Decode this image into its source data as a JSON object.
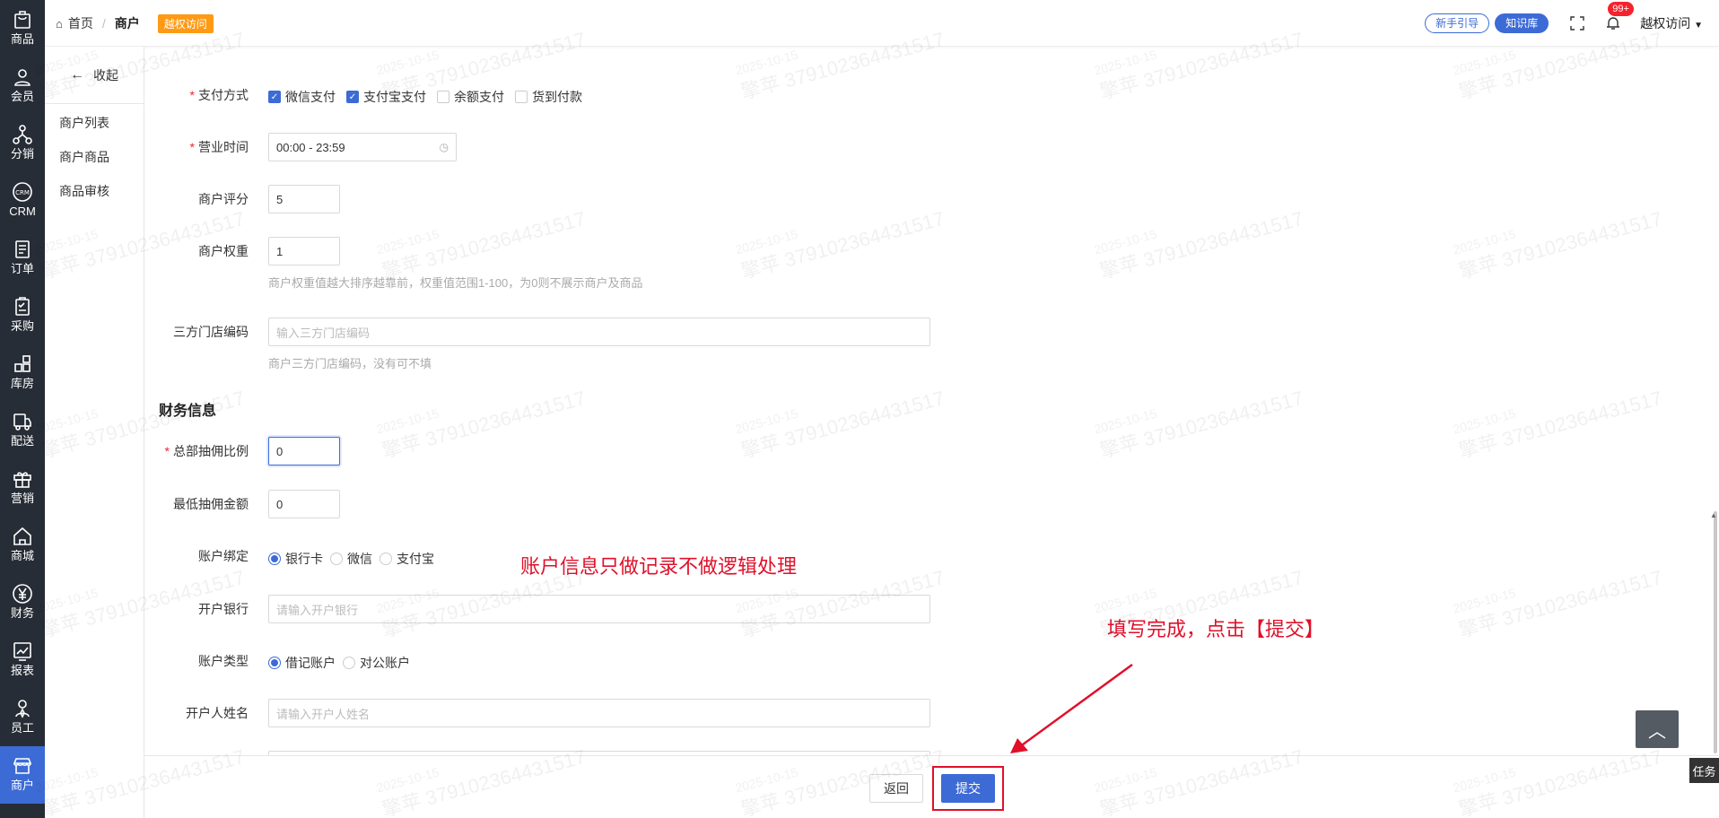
{
  "nav": {
    "items": [
      {
        "label": "商品",
        "icon": "bag-icon"
      },
      {
        "label": "会员",
        "icon": "user-icon"
      },
      {
        "label": "分销",
        "icon": "network-icon"
      },
      {
        "label": "CRM",
        "icon": "crm-icon"
      },
      {
        "label": "订单",
        "icon": "order-icon"
      },
      {
        "label": "采购",
        "icon": "purchase-icon"
      },
      {
        "label": "库房",
        "icon": "warehouse-icon"
      },
      {
        "label": "配送",
        "icon": "truck-icon"
      },
      {
        "label": "营销",
        "icon": "gift-icon"
      },
      {
        "label": "商城",
        "icon": "home-icon"
      },
      {
        "label": "财务",
        "icon": "yen-icon"
      },
      {
        "label": "报表",
        "icon": "chart-icon"
      },
      {
        "label": "员工",
        "icon": "staff-icon"
      },
      {
        "label": "商户",
        "icon": "store-icon"
      }
    ],
    "active": "商户"
  },
  "subnav": {
    "collapse_label": "收起",
    "items": [
      "商户列表",
      "商户商品",
      "商品审核"
    ]
  },
  "header": {
    "home": "首页",
    "current": "商户",
    "badge": "越权访问",
    "guide_button": "新手引导",
    "kb_button": "知识库",
    "bell_count": "99+",
    "user": "越权访问"
  },
  "form": {
    "payment": {
      "label": "支付方式",
      "options": [
        {
          "label": "微信支付",
          "checked": true
        },
        {
          "label": "支付宝支付",
          "checked": true
        },
        {
          "label": "余额支付",
          "checked": false
        },
        {
          "label": "货到付款",
          "checked": false
        }
      ]
    },
    "hours": {
      "label": "营业时间",
      "value": "00:00 - 23:59"
    },
    "rating": {
      "label": "商户评分",
      "value": "5"
    },
    "weight": {
      "label": "商户权重",
      "value": "1",
      "hint": "商户权重值越大排序越靠前，权重值范围1-100，为0则不展示商户及商品"
    },
    "third_code": {
      "label": "三方门店编码",
      "placeholder": "输入三方门店编码",
      "hint": "商户三方门店编码，没有可不填"
    },
    "finance_title": "财务信息",
    "commission_rate": {
      "label": "总部抽佣比例",
      "value": "0"
    },
    "min_commission": {
      "label": "最低抽佣金额",
      "value": "0"
    },
    "account_bind": {
      "label": "账户绑定",
      "options": [
        {
          "label": "银行卡",
          "checked": true
        },
        {
          "label": "微信",
          "checked": false
        },
        {
          "label": "支付宝",
          "checked": false
        }
      ]
    },
    "bank": {
      "label": "开户银行",
      "placeholder": "请输入开户银行"
    },
    "account_type": {
      "label": "账户类型",
      "options": [
        {
          "label": "借记账户",
          "checked": true
        },
        {
          "label": "对公账户",
          "checked": false
        }
      ]
    },
    "holder": {
      "label": "开户人姓名",
      "placeholder": "请输入开户人姓名"
    }
  },
  "footer": {
    "back_label": "返回",
    "submit_label": "提交"
  },
  "annotations": {
    "note1": "账户信息只做记录不做逻辑处理",
    "note2": "填写完成，点击【提交】",
    "color": "#e0102a"
  },
  "float": {
    "task_label": "任务"
  },
  "watermark": {
    "text": "擎苹 379102364431517",
    "date": "2025-10-15"
  },
  "colors": {
    "accent": "#3d6bd6",
    "nav_bg": "#272d36",
    "badge": "#ff9a14"
  }
}
